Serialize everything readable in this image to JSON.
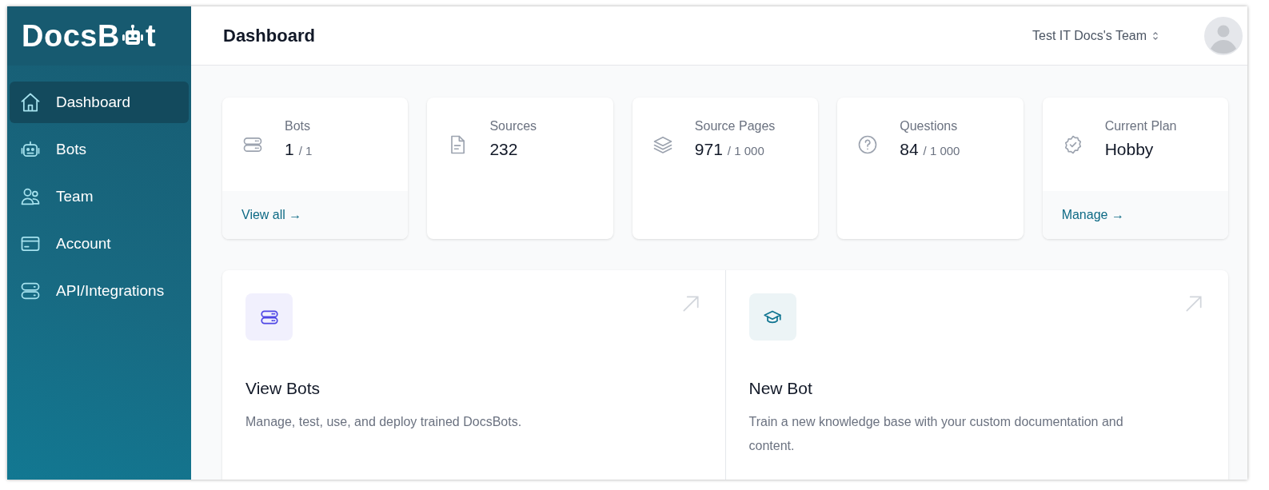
{
  "logo": {
    "before": "DocsB",
    "after": "t"
  },
  "sidebar": {
    "items": [
      {
        "label": "Dashboard",
        "selected": true
      },
      {
        "label": "Bots",
        "selected": false
      },
      {
        "label": "Team",
        "selected": false
      },
      {
        "label": "Account",
        "selected": false
      },
      {
        "label": "API/Integrations",
        "selected": false
      }
    ]
  },
  "header": {
    "title": "Dashboard",
    "team": "Test IT Docs's Team"
  },
  "stats": [
    {
      "label": "Bots",
      "value": "1",
      "limit": "/ 1",
      "link": "View all →"
    },
    {
      "label": "Sources",
      "value": "232"
    },
    {
      "label": "Source Pages",
      "value": "971",
      "limit": "/ 1 000"
    },
    {
      "label": "Questions",
      "value": "84",
      "limit": "/ 1 000"
    },
    {
      "label": "Current Plan",
      "value": "Hobby",
      "link": "Manage →"
    }
  ],
  "actions": [
    {
      "title": "View Bots",
      "description": "Manage, test, use, and deploy trained DocsBots.",
      "color": "#4f46e5"
    },
    {
      "title": "New Bot",
      "description": "Train a new knowledge base with your custom documentation and content.",
      "color": "#0e7490"
    }
  ]
}
